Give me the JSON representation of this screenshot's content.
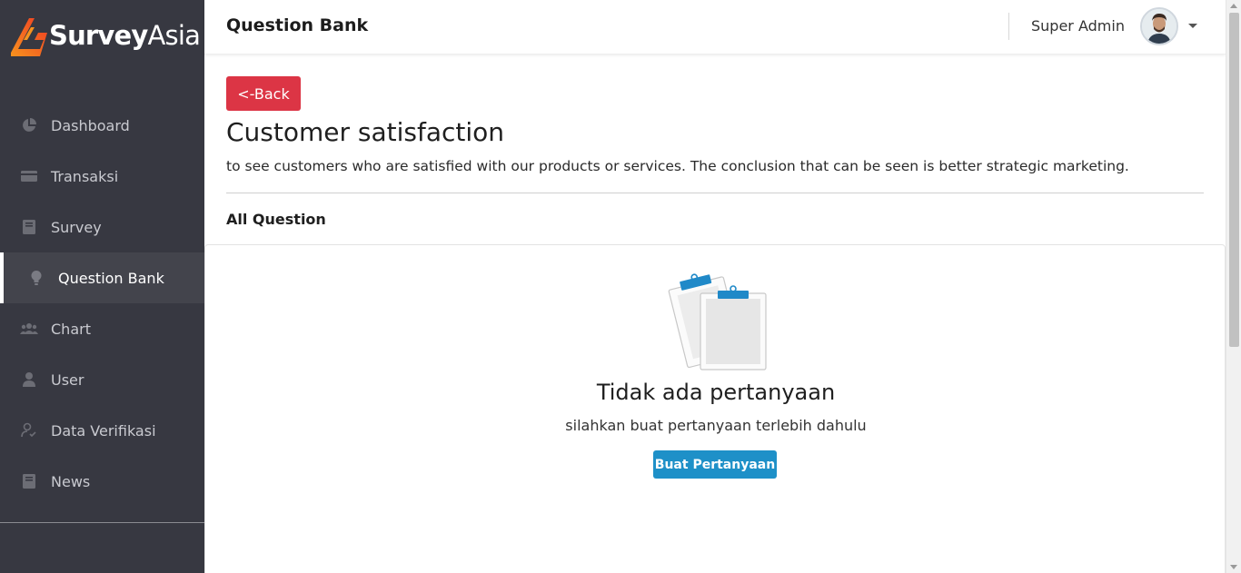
{
  "brand": {
    "name_part1": "Survey",
    "name_part2": "Asia",
    "accent": "#f15a24"
  },
  "sidebar": {
    "items": [
      {
        "label": "Dashboard",
        "icon": "pie-chart-icon",
        "active": false
      },
      {
        "label": "Transaksi",
        "icon": "card-icon",
        "active": false
      },
      {
        "label": "Survey",
        "icon": "book-icon",
        "active": false
      },
      {
        "label": "Question Bank",
        "icon": "lightbulb-icon",
        "active": true
      },
      {
        "label": "Chart",
        "icon": "users-icon",
        "active": false
      },
      {
        "label": "User",
        "icon": "user-icon",
        "active": false
      },
      {
        "label": "Data Verifikasi",
        "icon": "user-check-icon",
        "active": false
      },
      {
        "label": "News",
        "icon": "book-icon",
        "active": false
      }
    ]
  },
  "header": {
    "title": "Question Bank",
    "user_name": "Super Admin"
  },
  "content": {
    "back_label": "<-Back",
    "survey_title": "Customer satisfaction",
    "survey_description": "to see customers who are satisfied with our products or services. The conclusion that can be seen is better strategic marketing.",
    "section_title": "All Question",
    "empty_title": "Tidak ada pertanyaan",
    "empty_subtitle": "silahkan buat pertanyaan terlebih dahulu",
    "create_label": "Buat Pertanyaan"
  },
  "colors": {
    "sidebar_bg": "#373841",
    "back_button": "#dc3545",
    "create_button": "#1e90c8"
  }
}
